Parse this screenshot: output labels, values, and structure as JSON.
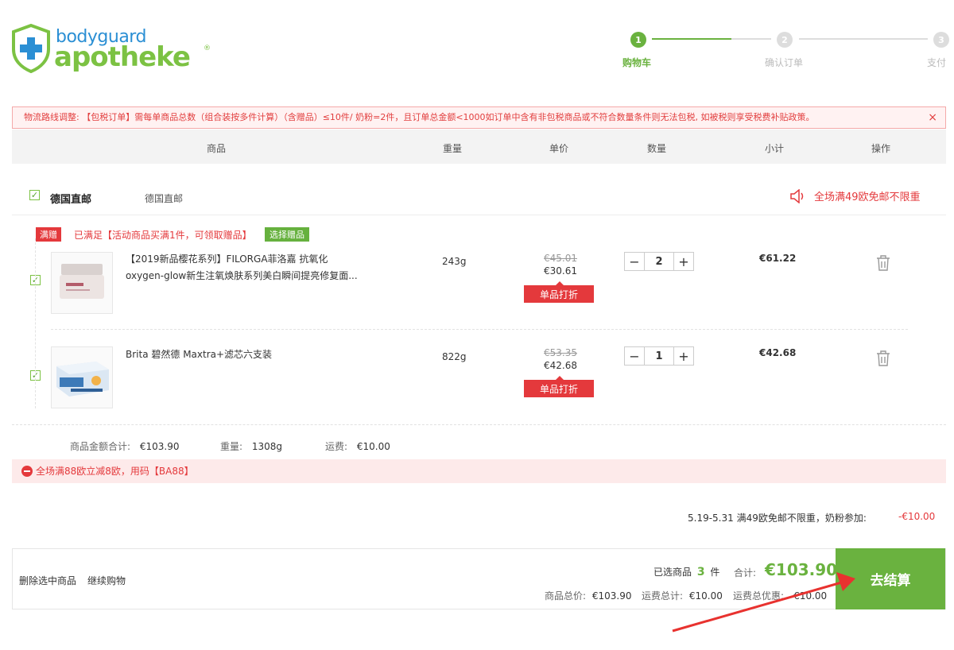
{
  "logo": {
    "line1": "bodyguard",
    "line2": "apotheke",
    "reg": "®"
  },
  "steps": [
    {
      "num": "1",
      "label": "购物车"
    },
    {
      "num": "2",
      "label": "确认订单"
    },
    {
      "num": "3",
      "label": "支付"
    }
  ],
  "notice": {
    "text": "物流路线调整: 【包税订单】需每单商品总数（组合装按多件计算）（含赠品）≤10件/ 奶粉=2件，且订单总金额<1000如订单中含有非包税商品或不符合数量条件则无法包税, 如被税则享受税费补贴政策。",
    "close": "×"
  },
  "table_header": {
    "product": "商品",
    "weight": "重量",
    "unit_price": "单价",
    "quantity": "数量",
    "subtotal": "小计",
    "action": "操作"
  },
  "shop": {
    "name": "德国直邮",
    "subname": "德国直邮",
    "free_shipping": "全场满49欧免邮不限重"
  },
  "gift": {
    "tag": "满赠",
    "text": "已满足【活动商品买满1件，可领取赠品】",
    "button": "选择赠品"
  },
  "items": [
    {
      "name_line1": "【2019新品樱花系列】FILORGA菲洛嘉 抗氧化",
      "name_line2": "oxygen-glow新生注氧焕肤系列美白瞬间提亮修复面...",
      "weight": "243g",
      "old_price": "€45.01",
      "new_price": "€30.61",
      "badge": "单品打折",
      "qty": "2",
      "subtotal": "€61.22"
    },
    {
      "name_line1": "Brita 碧然德 Maxtra+滤芯六支装",
      "name_line2": "",
      "weight": "822g",
      "old_price": "€53.35",
      "new_price": "€42.68",
      "badge": "单品打折",
      "qty": "1",
      "subtotal": "€42.68"
    }
  ],
  "summary": {
    "goods_label": "商品金额合计:",
    "goods_value": "€103.90",
    "weight_label": "重量:",
    "weight_value": "1308g",
    "shipping_label": "运费:",
    "shipping_value": "€10.00"
  },
  "promo": {
    "text": "全场满88欧立减8欧，用码【BA88】"
  },
  "discount_line": {
    "label": "5.19-5.31 满49欧免邮不限重，奶粉参加:",
    "value": "-€10.00"
  },
  "bottom": {
    "delete_selected": "删除选中商品",
    "continue_shopping": "继续购物",
    "selected_label": "已选商品",
    "selected_count": "3",
    "selected_unit": "件",
    "total_label": "合计:",
    "total_value": "€103.90",
    "goods_total_label": "商品总价:",
    "goods_total_value": "€103.90",
    "ship_total_label": "运费总计:",
    "ship_total_value": "€10.00",
    "ship_discount_label": "运费总优惠:",
    "ship_discount_value": "-€10.00",
    "checkout": "去结算"
  },
  "colors": {
    "brand_green": "#7cc243",
    "brand_blue": "#2b8fd4",
    "accent_red": "#e4393c",
    "checkout_green": "#6ab23f"
  }
}
